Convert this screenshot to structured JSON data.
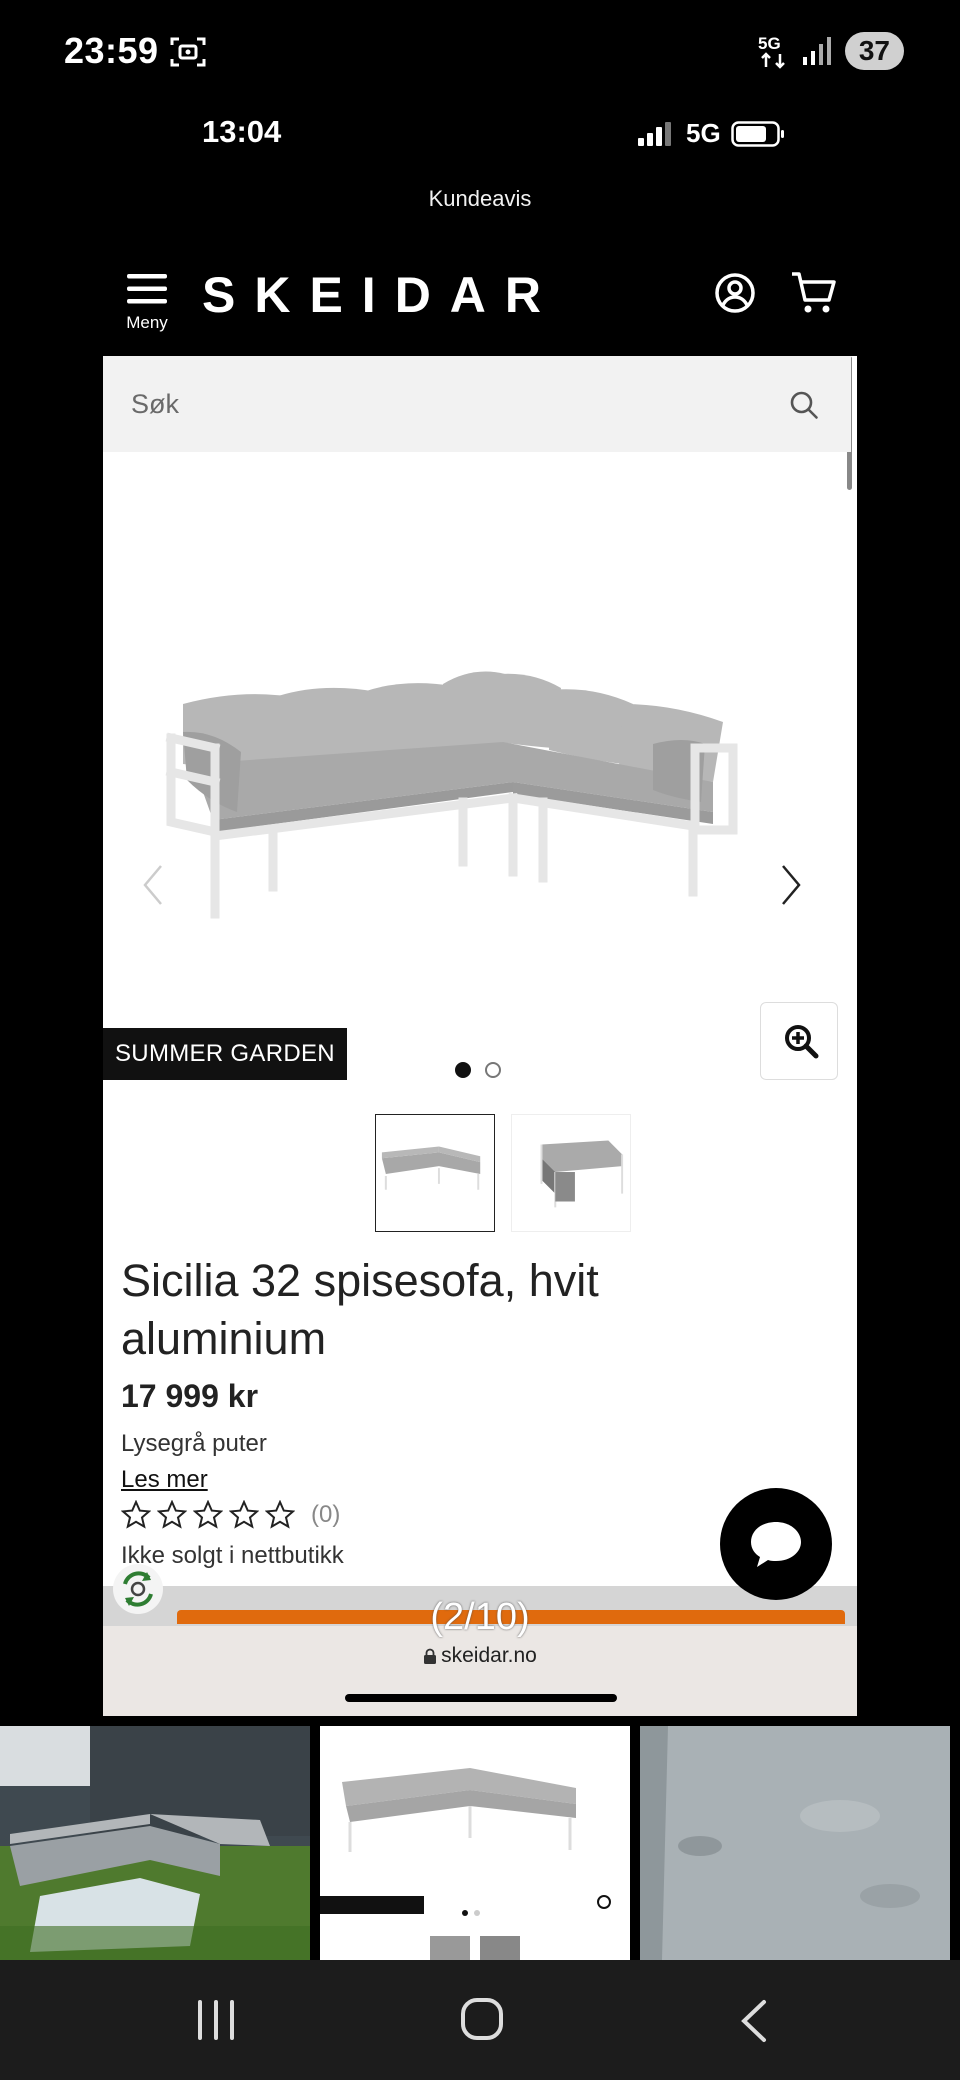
{
  "outer_status": {
    "time": "23:59",
    "network": "5G",
    "battery": "37"
  },
  "inner_status": {
    "time": "13:04",
    "network": "5G"
  },
  "promo_link": "Kundeavis",
  "header": {
    "menu_label": "Meny",
    "logo": "SKEIDAR"
  },
  "search": {
    "placeholder": "Søk"
  },
  "product": {
    "brand_tag": "SUMMER GARDEN",
    "title": "Sicilia 32 spisesofa, hvit aluminium",
    "price": "17 999 kr",
    "variant": "Lysegrå puter",
    "read_more": "Les mer",
    "rating_count": "(0)",
    "sold_note": "Ikke solgt i nettbutikk",
    "image_count": 2,
    "active_image": 1
  },
  "gallery_counter": "(2/10)",
  "browser": {
    "url": "skeidar.no"
  },
  "colors": {
    "accent": "#e06a0d",
    "background": "#000000",
    "page": "#ffffff"
  },
  "icons": [
    "screenshot-icon",
    "5g-icon",
    "signal-icon",
    "menu-icon",
    "user-icon",
    "cart-icon",
    "search-icon",
    "zoom-in-icon",
    "chat-icon",
    "recycle-icon",
    "lock-icon",
    "recent-apps-icon",
    "home-icon",
    "back-icon"
  ]
}
